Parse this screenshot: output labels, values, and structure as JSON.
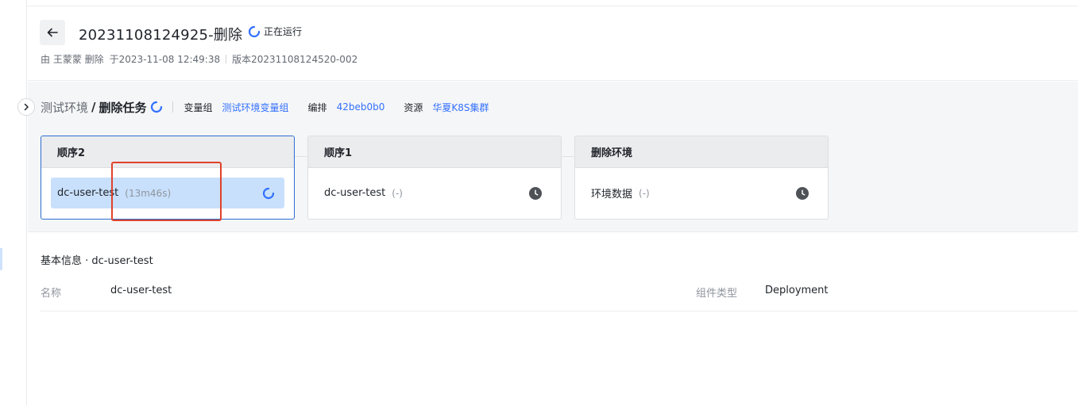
{
  "header": {
    "title": "20231108124925-删除",
    "status": "正在运行",
    "meta": {
      "operator": "由 王蒙蒙 删除",
      "time": "于2023-11-08 12:49:38",
      "version": "版本20231108124520-002"
    }
  },
  "stage_bar": {
    "env": "测试环境",
    "slash": "/",
    "task": "删除任务",
    "variable_group_label": "变量组",
    "variable_group_value": "测试环境变量组",
    "orchestration_label": "编排",
    "orchestration_value": "42beb0b0",
    "resource_label": "资源",
    "resource_value": "华夏K8S集群"
  },
  "stages": [
    {
      "title": "顺序2",
      "task": "dc-user-test",
      "time": "(13m46s)",
      "state": "running",
      "icon": "spinner-icon"
    },
    {
      "title": "顺序1",
      "task": "dc-user-test",
      "time": "(-)",
      "state": "waiting",
      "icon": "clock-icon"
    },
    {
      "title": "删除环境",
      "task": "环境数据",
      "time": "(-)",
      "state": "waiting",
      "icon": "clock-icon"
    }
  ],
  "info": {
    "title": "基本信息 · dc-user-test",
    "name_label": "名称",
    "name_value": "dc-user-test",
    "type_label": "组件类型",
    "type_value": "Deployment"
  },
  "colors": {
    "accent": "#3370ff",
    "selected_border": "#2c6fd1",
    "active_task_bg": "#c8e0fb",
    "annotation": "#e0422c"
  }
}
